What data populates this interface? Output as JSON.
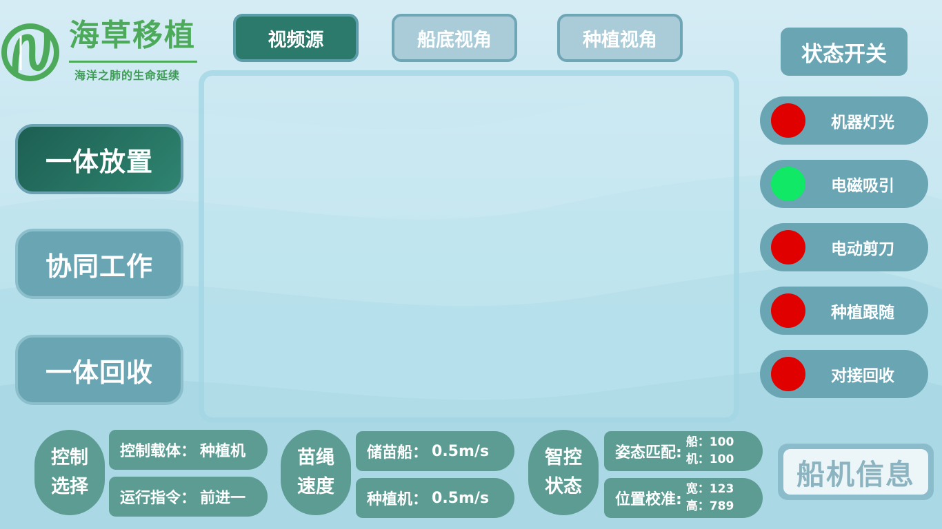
{
  "app": {
    "logo_title": "海草移植",
    "logo_subtitle": "海洋之肺的生命延续"
  },
  "tabs": [
    {
      "label": "视频源",
      "active": true
    },
    {
      "label": "船底视角",
      "active": false
    },
    {
      "label": "种植视角",
      "active": false
    }
  ],
  "modes": [
    {
      "label": "一体放置",
      "active": true
    },
    {
      "label": "协同工作",
      "active": false
    },
    {
      "label": "一体回收",
      "active": false
    }
  ],
  "status_panel": {
    "title": "状态开关",
    "switches": [
      {
        "label": "机器灯光",
        "state": "off",
        "color": "#e00000"
      },
      {
        "label": "电磁吸引",
        "state": "on",
        "color": "#11e866"
      },
      {
        "label": "电动剪刀",
        "state": "off",
        "color": "#e00000"
      },
      {
        "label": "种植跟随",
        "state": "off",
        "color": "#e00000"
      },
      {
        "label": "对接回收",
        "state": "off",
        "color": "#e00000"
      }
    ]
  },
  "control": {
    "head_line1": "控制",
    "head_line2": "选择",
    "carrier_key": "控制载体：",
    "carrier_value": "种植机",
    "command_key": "运行指令：",
    "command_value": "前进一"
  },
  "rope_speed": {
    "head_line1": "苗绳",
    "head_line2": "速度",
    "storage_key": "储苗船：",
    "storage_value": "0.5m/s",
    "planter_key": "种植机：",
    "planter_value": "0.5m/s"
  },
  "smart": {
    "head_line1": "智控",
    "head_line2": "状态",
    "attitude_key": "姿态匹配:",
    "attitude_ship": "船：100",
    "attitude_machine": "机：100",
    "position_key": "位置校准:",
    "position_width": "宽：123",
    "position_height": "高：789"
  },
  "info_button": {
    "label": "船机信息"
  },
  "colors": {
    "accent": "#2b7a6b",
    "panel": "#6aa5b4",
    "bottom_panel": "#5d9c93",
    "logo_green": "#4daa5b",
    "off": "#e00000",
    "on": "#11e866"
  }
}
